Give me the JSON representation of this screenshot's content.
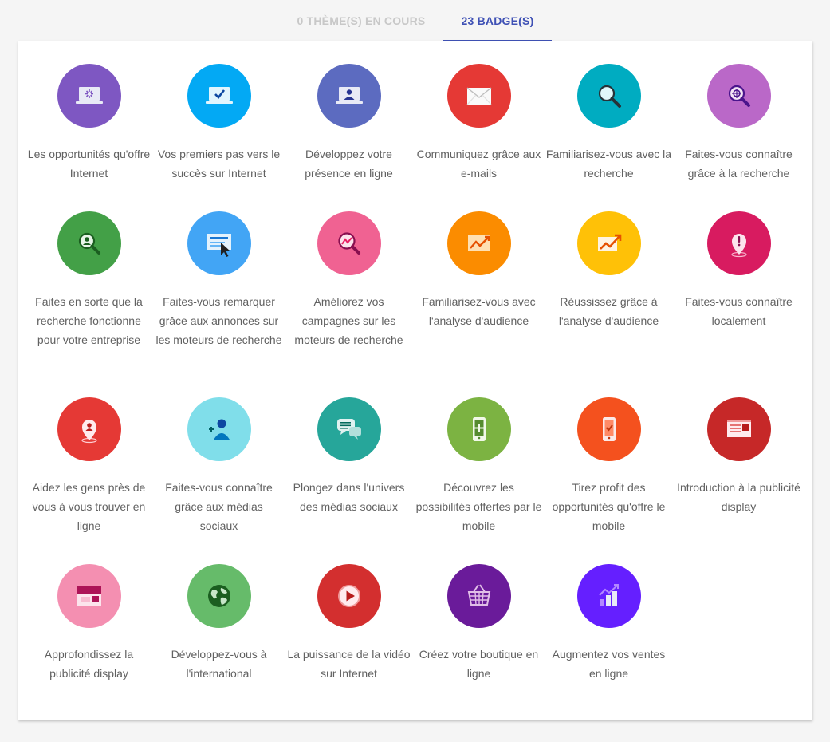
{
  "tabs": {
    "in_progress": "0 THÈME(S) EN COURS",
    "badges": "23 BADGE(S)"
  },
  "badges": [
    {
      "label": "Les opportunités qu'offre Internet",
      "color": "#7e57c2",
      "icon": "laptop-loading-icon"
    },
    {
      "label": "Vos premiers pas vers le succès sur Internet",
      "color": "#03a9f4",
      "icon": "laptop-check-icon"
    },
    {
      "label": "Développez votre présence en ligne",
      "color": "#5c6bc0",
      "icon": "laptop-user-icon"
    },
    {
      "label": "Communiquez grâce aux e-mails",
      "color": "#e53935",
      "icon": "envelope-icon"
    },
    {
      "label": "Familiarisez-vous avec la recherche",
      "color": "#00acc1",
      "icon": "magnifier-icon"
    },
    {
      "label": "Faites-vous connaître grâce à la recherche",
      "color": "#ba68c8",
      "icon": "magnifier-target-icon"
    },
    {
      "label": "Faites en sorte que la recherche fonctionne pour votre entreprise",
      "color": "#43a047",
      "icon": "magnifier-user-icon"
    },
    {
      "label": "Faites-vous remarquer grâce aux annonces sur les moteurs de recherche",
      "color": "#42a5f5",
      "icon": "ad-cursor-icon"
    },
    {
      "label": "Améliorez vos campagnes sur les moteurs de recherche",
      "color": "#f06292",
      "icon": "magnifier-trend-icon"
    },
    {
      "label": "Familiarisez-vous avec l'analyse d'audience",
      "color": "#fb8c00",
      "icon": "trend-chart-icon"
    },
    {
      "label": "Réussissez grâce à l'analyse d'audience",
      "color": "#ffc107",
      "icon": "trend-up-icon"
    },
    {
      "label": "Faites-vous connaître localement",
      "color": "#d81b60",
      "icon": "map-pin-alert-icon"
    },
    {
      "label": "Aidez les gens près de vous à vous trouver en ligne",
      "color": "#e53935",
      "icon": "map-pin-user-icon"
    },
    {
      "label": "Faites-vous connaître grâce aux médias sociaux",
      "color": "#80deea",
      "icon": "add-user-icon"
    },
    {
      "label": "Plongez dans l'univers des médias sociaux",
      "color": "#26a69a",
      "icon": "chat-bubbles-icon"
    },
    {
      "label": "Découvrez les possibilités offertes par le mobile",
      "color": "#7cb342",
      "icon": "mobile-plus-icon"
    },
    {
      "label": "Tirez profit des opportunités qu'offre le mobile",
      "color": "#f4511e",
      "icon": "mobile-check-icon"
    },
    {
      "label": "Introduction à la publicité display",
      "color": "#c62828",
      "icon": "display-ad-icon"
    },
    {
      "label": "Approfondissez la publicité display",
      "color": "#f48fb1",
      "icon": "display-banner-icon"
    },
    {
      "label": "Développez-vous à l'international",
      "color": "#66bb6a",
      "icon": "globe-icon"
    },
    {
      "label": "La puissance de la vidéo sur Internet",
      "color": "#d32f2f",
      "icon": "play-icon"
    },
    {
      "label": "Créez votre boutique en ligne",
      "color": "#6a1b9a",
      "icon": "shopping-basket-icon"
    },
    {
      "label": "Augmentez vos ventes en ligne",
      "color": "#651fff",
      "icon": "sales-growth-icon"
    }
  ]
}
